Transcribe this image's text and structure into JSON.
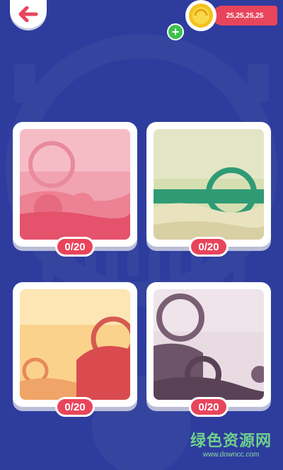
{
  "header": {
    "back_icon": "arrow-left-icon",
    "coins": "25,25,25,25"
  },
  "levels": [
    {
      "id": "level-1",
      "progress": "0/20",
      "theme": "pink-desert"
    },
    {
      "id": "level-2",
      "progress": "0/20",
      "theme": "green-sea"
    },
    {
      "id": "level-3",
      "progress": "0/20",
      "theme": "sunset"
    },
    {
      "id": "level-4",
      "progress": "0/20",
      "theme": "dusk"
    }
  ],
  "watermark": {
    "title": "绿色资源网",
    "url": "www.downcc.com"
  },
  "colors": {
    "background": "#2e3c9e",
    "accent": "#e8455c",
    "plus": "#3cc24b"
  }
}
